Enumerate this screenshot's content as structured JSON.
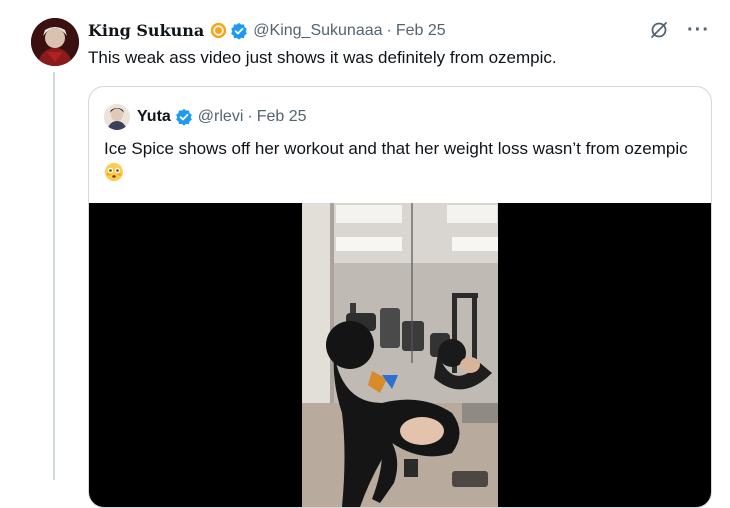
{
  "tweet": {
    "author_name": "King Sukuna",
    "handle": "@King_Sukunaaa",
    "separator": "·",
    "date": "Feb 25",
    "text": "This weak ass video just shows it was definitely from ozempic.",
    "more_label": "···"
  },
  "quoted": {
    "author_name": "Yuta",
    "handle": "@rlevi",
    "separator": "·",
    "date": "Feb 25",
    "text": "Ice Spice shows off her workout and that her weight loss wasn’t from ozempic"
  },
  "colors": {
    "text_primary": "#0f1419",
    "text_secondary": "#536471",
    "verified_blue": "#1d9bf0",
    "border": "#cfd9de"
  },
  "icons": {
    "verified": "verified-badge-icon",
    "grok": "grok-icon",
    "more": "more-icon",
    "emoji_badge": "emoji-badge-icon",
    "flushed": "flushed-face-emoji"
  }
}
